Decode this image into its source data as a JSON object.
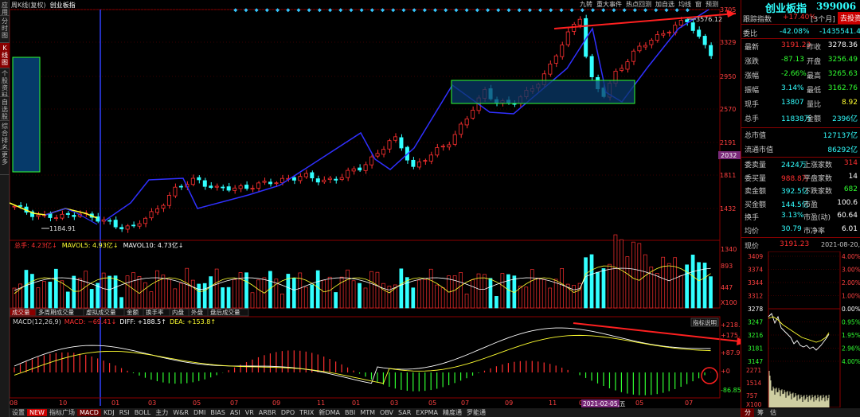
{
  "side_tabs": [
    "应用",
    "分时图",
    "K线图",
    "个股资料",
    "自选股",
    "综合排名",
    "更多"
  ],
  "side_active": 2,
  "topbar": {
    "left": "周K线(复权)",
    "right": "创业板指"
  },
  "toolbar": [
    "九转",
    "重大事件",
    "热点回测",
    "加自选",
    "均线",
    "窗",
    "预测"
  ],
  "chart_data": {
    "type": "candlestick",
    "title": "创业板指",
    "y_ticks_price": [
      "3705",
      "3329",
      "2950",
      "2570",
      "2191",
      "1811",
      "1432"
    ],
    "price_current_tag": "2032",
    "x_labels": [
      "08",
      "10",
      "01",
      "03",
      "05",
      "07",
      "09",
      "11",
      "01",
      "03",
      "05",
      "07",
      "09",
      "11",
      "01",
      "03",
      "05",
      "07"
    ],
    "annotations": {
      "low": "1184.91",
      "high": "3576.12"
    },
    "cursor_date": "2021-02-05,五",
    "volume": {
      "legend_total": "总手: 4.23亿↓",
      "legend_ma5": "MAVOL5: 4.93亿↓",
      "legend_ma10": "MAVOL10: 4.73亿↓",
      "y_ticks": [
        "1340",
        "893",
        "447",
        "X100"
      ]
    },
    "macd": {
      "legend": "MACD(12,26,9)",
      "macd": "MACD: −69.41↓",
      "diff": "DIFF: +188.5↑",
      "dea": "DEA: +153.8↑",
      "y_ticks": [
        "+218.5",
        "+175.1",
        "+87.92",
        "+0",
        "-86.85"
      ]
    }
  },
  "vol_tabs": [
    "成交量",
    "多周期成交量",
    "虚拟成交量",
    "金额",
    "换手率",
    "内盘",
    "外盘",
    "盘后成交量"
  ],
  "macd_btn": "指标说明",
  "bottom_tabs": [
    "设置",
    "NEW",
    "指标广场",
    "MACD",
    "KDJ",
    "RSI",
    "BOLL",
    "主力",
    "W&R",
    "DMI",
    "BIAS",
    "ASI",
    "VR",
    "ARBR",
    "DPO",
    "TRIX",
    "新DMA",
    "BBI",
    "MTM",
    "OBV",
    "SAR",
    "EXPMA",
    "精度通",
    "罗能通"
  ],
  "right": {
    "name": "创业板指",
    "code": "399006",
    "track_label": "跟踪指数",
    "track_value": "+17.40%",
    "track_period": "[3个月]",
    "buy_btn": "去投资",
    "weibi": {
      "label": "委比",
      "pct": "-42.08%",
      "val": "-1435541.4"
    },
    "rows": [
      {
        "l": "最新",
        "v": "3191.23",
        "l2": "昨收",
        "v2": "3278.36",
        "c1": "red",
        "c2": "wht"
      },
      {
        "l": "涨跌",
        "v": "-87.13",
        "l2": "开盘",
        "v2": "3256.49",
        "c1": "grn",
        "c2": "grn"
      },
      {
        "l": "涨幅",
        "v": "-2.66%",
        "l2": "最高",
        "v2": "3265.63",
        "c1": "grn",
        "c2": "grn"
      },
      {
        "l": "振幅",
        "v": "3.14%",
        "l2": "最低",
        "v2": "3162.76",
        "c1": "cyan",
        "c2": "grn"
      },
      {
        "l": "现手",
        "v": "13807",
        "l2": "量比",
        "v2": "8.92",
        "c1": "cyan",
        "c2": "yel"
      },
      {
        "l": "总手",
        "v": "11838万",
        "l2": "金额",
        "v2": "2396亿",
        "c1": "cyan",
        "c2": "cyan"
      }
    ],
    "mcap": [
      {
        "l": "总市值",
        "v": "127137亿"
      },
      {
        "l": "流通市值",
        "v": "86292亿"
      }
    ],
    "rows2": [
      {
        "l": "委卖量",
        "v": "2424万",
        "l2": "上涨家数",
        "v2": "314",
        "c1": "cyan",
        "c2": "red"
      },
      {
        "l": "委买量",
        "v": "988.8万",
        "l2": "平盘家数",
        "v2": "14",
        "c1": "red",
        "c2": "wht"
      },
      {
        "l": "卖金额",
        "v": "392.5亿",
        "l2": "下跌家数",
        "v2": "682",
        "c1": "cyan",
        "c2": "grn"
      },
      {
        "l": "买金额",
        "v": "144.5亿",
        "l2": "市盈",
        "v2": "100.6",
        "c1": "cyan",
        "c2": "wht"
      },
      {
        "l": "换手",
        "v": "3.13%",
        "l2": "市盈(动)",
        "v2": "60.64",
        "c1": "cyan",
        "c2": "wht"
      },
      {
        "l": "均价",
        "v": "30.79",
        "l2": "市净率",
        "v2": "6.01",
        "c1": "cyan",
        "c2": "wht"
      }
    ],
    "mini": {
      "label": "现价",
      "price": "3191.23",
      "date": "2021-08-20,五",
      "left_ticks": [
        "3409",
        "3374",
        "3344",
        "3312",
        "3278",
        "3247",
        "3216",
        "3181",
        "3147"
      ],
      "right_ticks": [
        "4.00%",
        "3.00%",
        "2.00%",
        "1.00%",
        "0.00%",
        "0.95%",
        "1.95%",
        "2.96%",
        "4.00%"
      ],
      "vol_ticks": [
        "2271",
        "1514",
        "757",
        "X100"
      ]
    },
    "tabs": [
      "分",
      "筹",
      "估"
    ]
  }
}
